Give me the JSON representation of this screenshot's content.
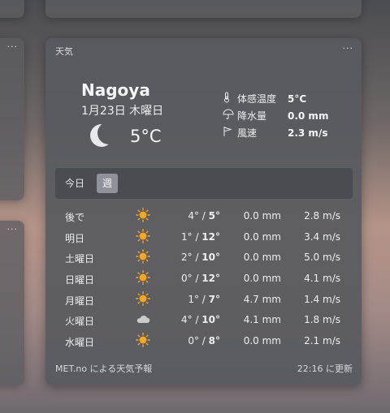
{
  "widget": {
    "title": "天気",
    "menu_label": "···",
    "side_menu_label": "···"
  },
  "current": {
    "city": "Nagoya",
    "date": "1月23日 木曜日",
    "condition_icon": "moon-icon",
    "temperature": "5°C"
  },
  "details": [
    {
      "icon": "thermometer-icon",
      "label": "体感温度",
      "value": "5°C"
    },
    {
      "icon": "umbrella-icon",
      "label": "降水量",
      "value": "0.0 mm"
    },
    {
      "icon": "flag-icon",
      "label": "風速",
      "value": "2.3 m/s"
    }
  ],
  "tabs": [
    {
      "label": "今日",
      "selected": false
    },
    {
      "label": "週",
      "selected": true
    }
  ],
  "forecast": [
    {
      "day": "後で",
      "icon": "sun-icon",
      "low": "4°",
      "high": "5°",
      "precip": "0.0 mm",
      "wind": "2.8 m/s"
    },
    {
      "day": "明日",
      "icon": "sun-icon",
      "low": "1°",
      "high": "12°",
      "precip": "0.0 mm",
      "wind": "3.4 m/s"
    },
    {
      "day": "土曜日",
      "icon": "sun-icon",
      "low": "2°",
      "high": "10°",
      "precip": "0.0 mm",
      "wind": "5.0 m/s"
    },
    {
      "day": "日曜日",
      "icon": "sun-icon",
      "low": "0°",
      "high": "12°",
      "precip": "0.0 mm",
      "wind": "4.1 m/s"
    },
    {
      "day": "月曜日",
      "icon": "sun-icon",
      "low": "1°",
      "high": "7°",
      "precip": "4.7 mm",
      "wind": "1.4 m/s"
    },
    {
      "day": "火曜日",
      "icon": "cloud-icon",
      "low": "4°",
      "high": "10°",
      "precip": "4.1 mm",
      "wind": "1.8 m/s"
    },
    {
      "day": "水曜日",
      "icon": "sun-icon",
      "low": "0°",
      "high": "8°",
      "precip": "0.0 mm",
      "wind": "2.1 m/s"
    }
  ],
  "footer": {
    "source": "MET.no による天気予報",
    "updated": "22:16 に更新"
  },
  "colors": {
    "sun": "#f5a623",
    "cloud": "#c8cacf",
    "moon": "#e8e9ec"
  }
}
